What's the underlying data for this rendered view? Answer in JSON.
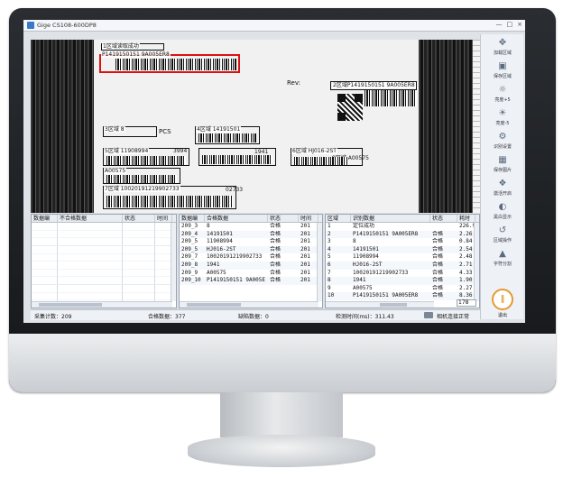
{
  "window": {
    "title": "Gige CS108-600DP8",
    "controls": [
      "—",
      "□",
      "×"
    ]
  },
  "image": {
    "labels": [
      "1区域读取成功",
      "P1419150151 9A005ER8",
      "Rev:",
      "2区域P1419150151 9A005ER8",
      "3区域 8",
      "PCS",
      "4区域 14191501",
      "5区域 11908994",
      "3994",
      "6区域 HJ016-2ST",
      "9区域 A00575",
      "A00575",
      "1941",
      "7区域 10020191219902733",
      "02733"
    ]
  },
  "toolbar": {
    "items": [
      {
        "label": "加载区域",
        "icon": "region-load-icon"
      },
      {
        "label": "保存区域",
        "icon": "save-icon"
      },
      {
        "label": "亮度+5",
        "icon": "brightness-up-icon"
      },
      {
        "label": "亮度-5",
        "icon": "brightness-down-icon"
      },
      {
        "label": "识别设置",
        "icon": "settings-icon"
      },
      {
        "label": "保存图片",
        "icon": "picture-icon"
      },
      {
        "label": "激活开启",
        "icon": "activate-icon"
      },
      {
        "label": "黑白显示",
        "icon": "contrast-icon"
      },
      {
        "label": "区域操作",
        "icon": "region-op-icon"
      },
      {
        "label": "字符分割",
        "icon": "split-icon"
      }
    ],
    "exit_label": "退出",
    "exit_icon": "power-icon"
  },
  "left_table": {
    "headers": [
      "数据编",
      "不合格数据",
      "状态",
      "时间"
    ]
  },
  "mid_table": {
    "headers": [
      "数据编",
      "合格数据",
      "状态",
      "时间"
    ],
    "rows": [
      [
        "209_3",
        "8",
        "合格",
        "201"
      ],
      [
        "209_4",
        "14191501",
        "合格",
        "201"
      ],
      [
        "209_5",
        "11908994",
        "合格",
        "201"
      ],
      [
        "209_5",
        "HJ016-2ST",
        "合格",
        "201"
      ],
      [
        "209_7",
        "10020191219902733",
        "合格",
        "201"
      ],
      [
        "209_8",
        "1941",
        "合格",
        "201"
      ],
      [
        "209_9",
        "A00575",
        "合格",
        "201"
      ],
      [
        "209_10",
        "P1419150151 9A005E",
        "合格",
        "201"
      ]
    ]
  },
  "right_table": {
    "headers": [
      "区域",
      "识别数据",
      "状态",
      "耗时"
    ],
    "rows": [
      [
        "1",
        "定位成功",
        "",
        "226.9"
      ],
      [
        "2",
        "P1419150151 9A005ER8",
        "合格",
        "2.26"
      ],
      [
        "3",
        "8",
        "合格",
        "0.84"
      ],
      [
        "4",
        "14191501",
        "合格",
        "2.54"
      ],
      [
        "5",
        "11908994",
        "合格",
        "2.48"
      ],
      [
        "6",
        "HJ016-2ST",
        "合格",
        "2.71"
      ],
      [
        "7",
        "10020191219902733",
        "合格",
        "4.33"
      ],
      [
        "8",
        "1941",
        "合格",
        "1.90"
      ],
      [
        "9",
        "A00575",
        "合格",
        "2.27"
      ],
      [
        "10",
        "P1419150151 9A005ER8",
        "合格",
        "8.36"
      ]
    ],
    "count": "178"
  },
  "status": {
    "total": "采集计数：209",
    "pass": "合格数据：377",
    "fail": "缺陷数据：0",
    "time": "检测时间(ms)：311.43",
    "camera": "相机连接正常"
  }
}
